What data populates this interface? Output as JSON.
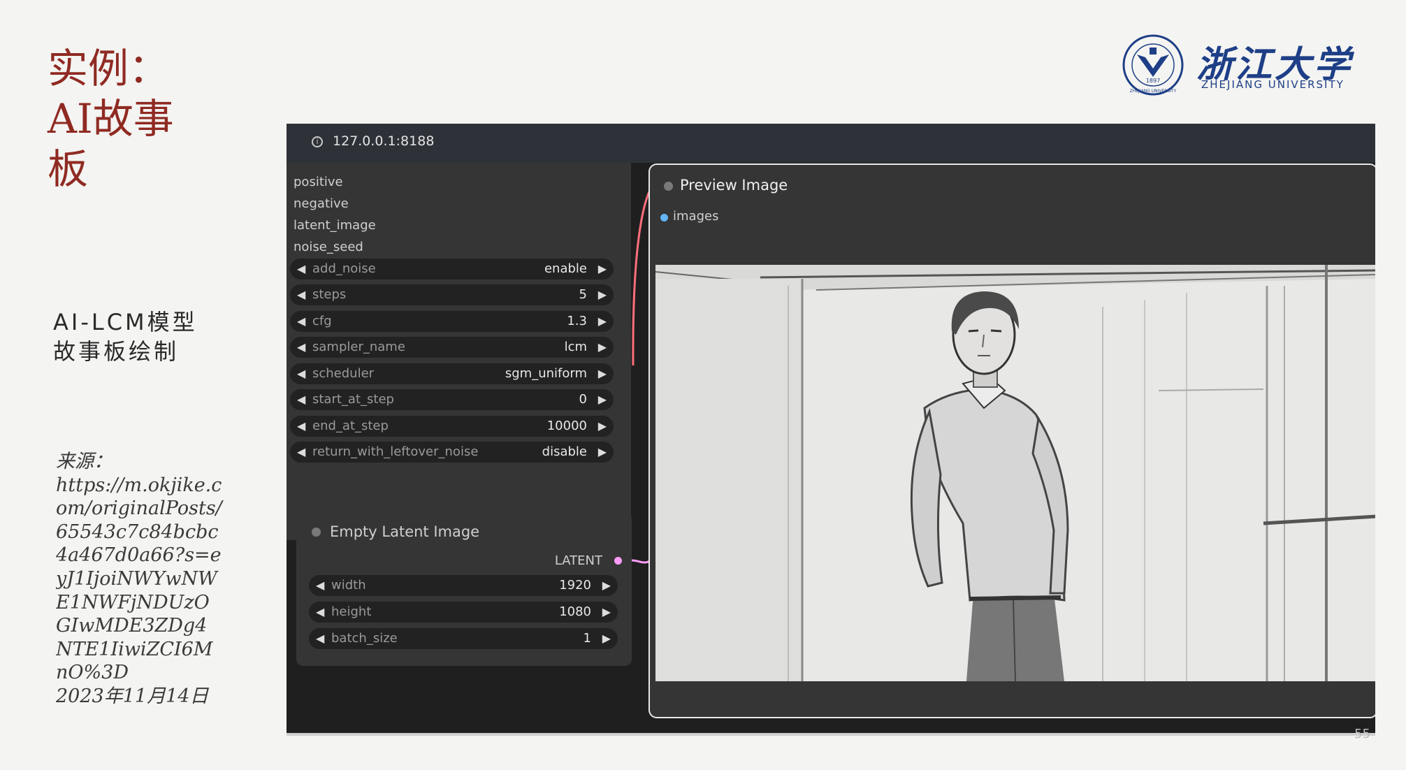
{
  "slide": {
    "title_lines": [
      "实例：",
      "AI故事",
      "板"
    ],
    "subtitle": "AI-LCM模型故事板绘制",
    "source_label": "来源：",
    "source_url": "https://m.okjike.com/originalPosts/65543c7c84bcbc4a467d0a66?s=eyJ1IjoiNWYwNWE1NWFjNDUzOGIwMDE3ZDg4NTE1IiwiZCI6MnO%3D",
    "date": "2023年11月14日",
    "page_number": "55"
  },
  "logo": {
    "cn": "浙江大学",
    "en": "ZHEJIANG UNIVERSITY",
    "seal_year": "1897",
    "seal_text": "ZHEJIANG UNIVERSITY"
  },
  "browser": {
    "url": "127.0.0.1:8188"
  },
  "sampler_node": {
    "inputs": [
      "positive",
      "negative",
      "latent_image",
      "noise_seed"
    ],
    "widgets": [
      {
        "name": "add_noise",
        "value": "enable"
      },
      {
        "name": "steps",
        "value": "5"
      },
      {
        "name": "cfg",
        "value": "1.3"
      },
      {
        "name": "sampler_name",
        "value": "lcm"
      },
      {
        "name": "scheduler",
        "value": "sgm_uniform"
      },
      {
        "name": "start_at_step",
        "value": "0"
      },
      {
        "name": "end_at_step",
        "value": "10000"
      },
      {
        "name": "return_with_leftover_noise",
        "value": "disable"
      }
    ]
  },
  "latent_node": {
    "title": "Empty Latent Image",
    "output": "LATENT",
    "widgets": [
      {
        "name": "width",
        "value": "1920"
      },
      {
        "name": "height",
        "value": "1080"
      },
      {
        "name": "batch_size",
        "value": "1"
      }
    ]
  },
  "preview_node": {
    "title": "Preview Image",
    "input": "images"
  },
  "colors": {
    "title_red": "#8f2a22",
    "zju_blue": "#1e3f87",
    "latent_link": "#ff9cf9",
    "image_link": "#64b5f6",
    "conditioning_link": "#ff6f7a"
  }
}
